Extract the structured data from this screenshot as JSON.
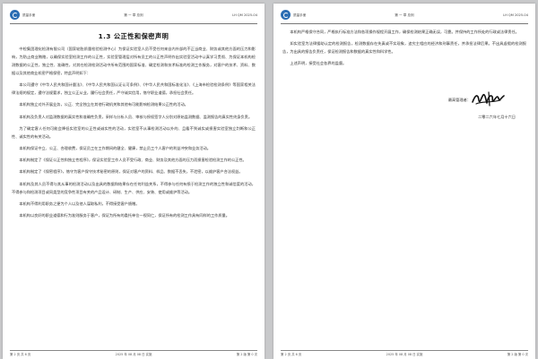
{
  "pages": [
    {
      "header": {
        "company": "质量手册",
        "chapter": "第 一 章  总则",
        "code": "LH QM 2025-04"
      },
      "title": "1.3 公正性和保密声明",
      "paragraphs": [
        "中检集团理化检测有限公司（国家轮胎质量检验检测中心）为保证实验室人员不受任何来自内外部的不正当商业、财务或其他方面的压力和影响，为防止商业贿赂，以确保实验室检测工作的公正性，实验室管理层对所有员工的公正性声明作出实验室活动中认真学习贯彻、为保证本机构检测数据的公正性，独立性、准确性，对其在检测检测活动中所有范围的国家标准、确定检测和技术标准的检测工作服务，对客户的技术、资料、数据以及其他商业机密严格保密，特此声明如下：",
        "本公司遵守《中华人民共和国计量法》、《中华人民共和国认证认可条例》、《中华人民共和国标准化法》、《上海市检验检测条例》等国家相关法律法规的规定，遵守法规要求，独立公正从业，履行社会责任，严守诚实信用，恪守职业道德，承担社会责任。",
        "本机构独立对外开展业务，公正、完全独立在其他行政机关和其他有可能影响检测结果公正性的活动。",
        "本机构及负责人对监测数据的真实性和准确性负责，采样与分析人员、审核与授权签字人分别对原始监测数据、监测报告的真实性终身负责。",
        "为了确定客人任何可能会降低实验室的公正性或诚实性的活动，实验室不从事检测活动以外的、且看不到诚实或损害实验室独立判断和公正性、诚实性的有关活动。",
        "本机构保证中立、公正、合理收费，保证员工在工作期间的健全、健康，禁止员工个人客户的利益冲突和业务活动。",
        "本机构制定了《保证公正性和独立性程序》，保证实验室工作人员不受行政、商业、财务及其他方面的压力而损害检验检测工作的公正性。",
        "本机构制定了《保密程序》，恪守为客户保守技术秘密的原则，保证对客户的资料、样品、数据不丢失，不泄密，以维护客户合法权益。",
        "本机构及其人员不得与其从事的检测活动以及出具的数据和结果存在任何利益关系，不得参与任何有损于检测工作的独立性和诚信度的活动，不得参与和检测项目或同类型的竞争性项目有关的产品设计、研制、生产、供应、安装、使用或维护等活动。",
        "本机构不得利用职务之便为个人以及他人谋取私利，不得接受客户馈赠。",
        "本机构以良好的职业道德和行为准则服务于客户，保证为所有的委托单位一视同仁，保证所有的检测工作具有同样的工作质量。"
      ],
      "footer": {
        "page": "第 2 页 共 6 页",
        "date": "2025 年 08 月 08 日 实施",
        "edition": "第 2 版 第 0 次"
      }
    },
    {
      "header": {
        "company": "质量手册",
        "chapter": "第 一 章  总则",
        "code": "LH QM 2025-04"
      },
      "paragraphs": [
        "本机构严格保守合同，严格执行标准方法和各项操作规程开展工作，确保检测结果正确无误，可靠。并保持的工作所处的行政或法律责任。",
        "如实验室为法律援助认定的检测报告，检测数据存在失真或不实现象，追究主相应的经济和刑事责任，并承担法律后果。不出具虚假的检测报告，为出具的报告负责任，保证检测报告和数据的真实性和科学性。"
      ],
      "statement": "上述声明，接受社会各界的监督。",
      "signature_label": "最高管理者：",
      "sign_date": "二零二六年七月十六日",
      "footer": {
        "page": "第 2 页 共 6 页",
        "date": "2025 年 08 月 08 日 实施",
        "edition": "第 2 版 第 0 次"
      }
    }
  ],
  "colors": {
    "logo": "#2a6db3",
    "background": "#c8c9cb",
    "text": "#333333"
  },
  "icons": {
    "logo": "company-logo-icon",
    "signature": "handwritten-signature"
  }
}
